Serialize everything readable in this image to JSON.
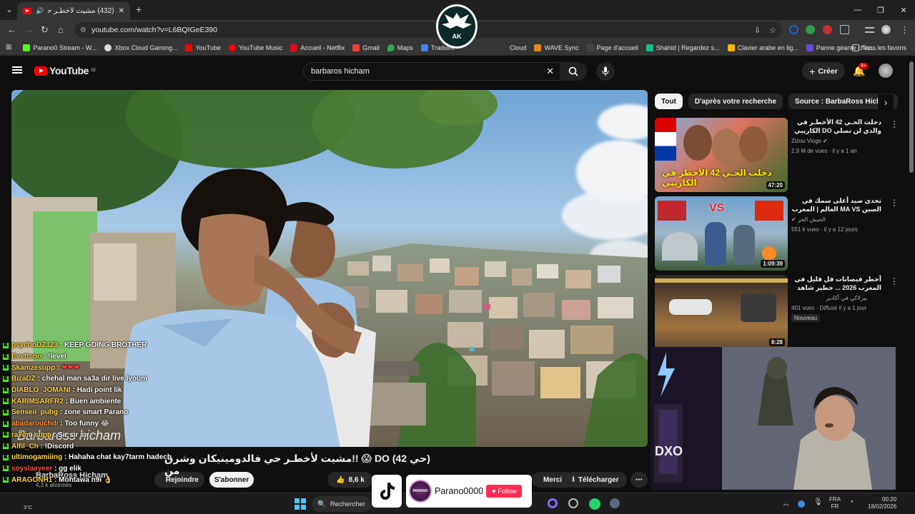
{
  "browser": {
    "tab_title": "(432) مشيت لأخطـر حي فالد",
    "url": "youtube.com/watch?v=L6BQIGeE390",
    "bookmarks": [
      "Parano0 Stream - W...",
      "Xbox Cloud Gaming...",
      "YouTube",
      "YouTube Music",
      "Accueil - Netflix",
      "Gmail",
      "Maps",
      "Traduire",
      "Cloud",
      "WAVE Sync",
      "Page d'accueil",
      "Shahid | Regardez s...",
      "Clavier arabe en lig...",
      "Panne géante chez..."
    ],
    "bookmarks_all": "Tous les favoris",
    "colors": {
      "tab_bg": "#353535",
      "chrome_bg": "#1f1f1f"
    }
  },
  "youtube": {
    "region": "BE",
    "search_query": "barbaros hicham",
    "create_label": "Créer",
    "notif_count": "9+",
    "video_title": "(حي 42) DO 😱 !!مشيت لأخطـر حي فالدومينيكان وشرق من",
    "channel_name": "BarbaRoss Hicham",
    "channel_subs": "4,3 k abonnés",
    "join_label": "Rejoindre",
    "subscribe_label": "S'abonner",
    "likes": "8,6 k",
    "thanks_label": "Merci",
    "download_label": "Télécharger",
    "chips": [
      "Tout",
      "D'après votre recherche",
      "Source : BarbaRoss Hicham"
    ],
    "recommendations": [
      {
        "title": "دخلت الحـي 42 الأخطـر في الكاريبي DO والذي لن تصلي زيارته",
        "channel": "Zizou Vlogs",
        "meta": "2,9 M de vues · il y a 1 an",
        "duration": "47:20",
        "thumb_text": "دخلت الحـي 42 الأخطر في الكاريبي",
        "badge": ""
      },
      {
        "title": "تحدي صيد أغلى سمك في العالم | المغرب MA VS الصين CN",
        "channel": "الجيش الحر",
        "meta": "551 k vues · il y a 12 jours",
        "duration": "1:09:39",
        "thumb_text": "VS",
        "badge": ""
      },
      {
        "title": "أخطر فيضانات قل قليل في المغرب 2026 ... خطير شاهد فيضانات تضرب القصر الكبير",
        "channel": "بيزلاكي في أكادير",
        "meta": "401 vues · Diffusé il y a 1 jour",
        "duration": "8:28",
        "thumb_text": "",
        "badge": "Nouveau"
      }
    ],
    "video_overlay_text": "Barbaross hicham"
  },
  "chat": [
    {
      "user": "psychoDZ123",
      "msg": "KEEP GOING BROTHER"
    },
    {
      "user": "Evettcoo",
      "msg": "!level"
    },
    {
      "user": "Skamzesupp",
      "msg": "❤❤❤"
    },
    {
      "user": "BizaDZ",
      "msg": "chehal man sa3a dir live lyoum"
    },
    {
      "user": "DIABLO_JOMANI",
      "msg": "Hadi point lik"
    },
    {
      "user": "KARIMSARFR2",
      "msg": "Buen ambiente"
    },
    {
      "user": "Senseii_pubg",
      "msg": "zone smart Parano"
    },
    {
      "user": "abadarouchdi",
      "msg": "Too funny 😂"
    },
    {
      "user": "ra7im_supp",
      "msg": "Sir sir sir"
    },
    {
      "user": "Alfil_Ch",
      "msg": "!Discord"
    },
    {
      "user": "ultimogamiiing",
      "msg": "Hahaha chat kay7tarm hadech"
    },
    {
      "user": "soyslaayeer",
      "msg": "gg elik"
    },
    {
      "user": "ARAGONH1",
      "msg": "Mohtawa n9i 👌"
    }
  ],
  "stream_overlay": {
    "logo_text": "PARANO",
    "tiktok_name": "Parano0000",
    "follow_label": "Follow"
  },
  "taskbar": {
    "search_label": "Rechercher",
    "lang1": "FRA",
    "lang2": "FR",
    "time": "00:20",
    "date": "18/02/2026",
    "weather": "3°C"
  }
}
